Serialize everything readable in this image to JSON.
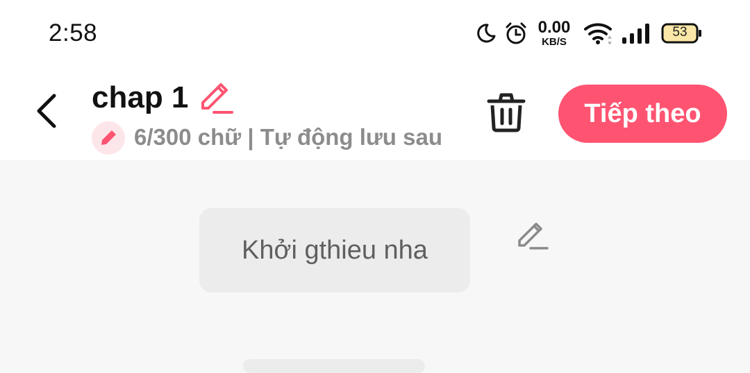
{
  "status_bar": {
    "time": "2:58",
    "net_speed_value": "0.00",
    "net_speed_unit": "KB/S",
    "battery": "53",
    "icons": [
      "moon-icon",
      "alarm-icon",
      "wifi-icon",
      "signal-icon",
      "battery-icon"
    ]
  },
  "header": {
    "title": "chap 1",
    "meta": "6/300 chữ | Tự động lưu sau",
    "next_label": "Tiếp theo"
  },
  "content": {
    "intro_text": "Khởi gthieu nha"
  },
  "colors": {
    "accent": "#fe5472",
    "accent_soft": "#fde6ea",
    "header_bg": "#ffffff",
    "page_bg": "#f7f7f7",
    "box_bg": "#ececec",
    "muted_text": "#8c8c8c"
  }
}
